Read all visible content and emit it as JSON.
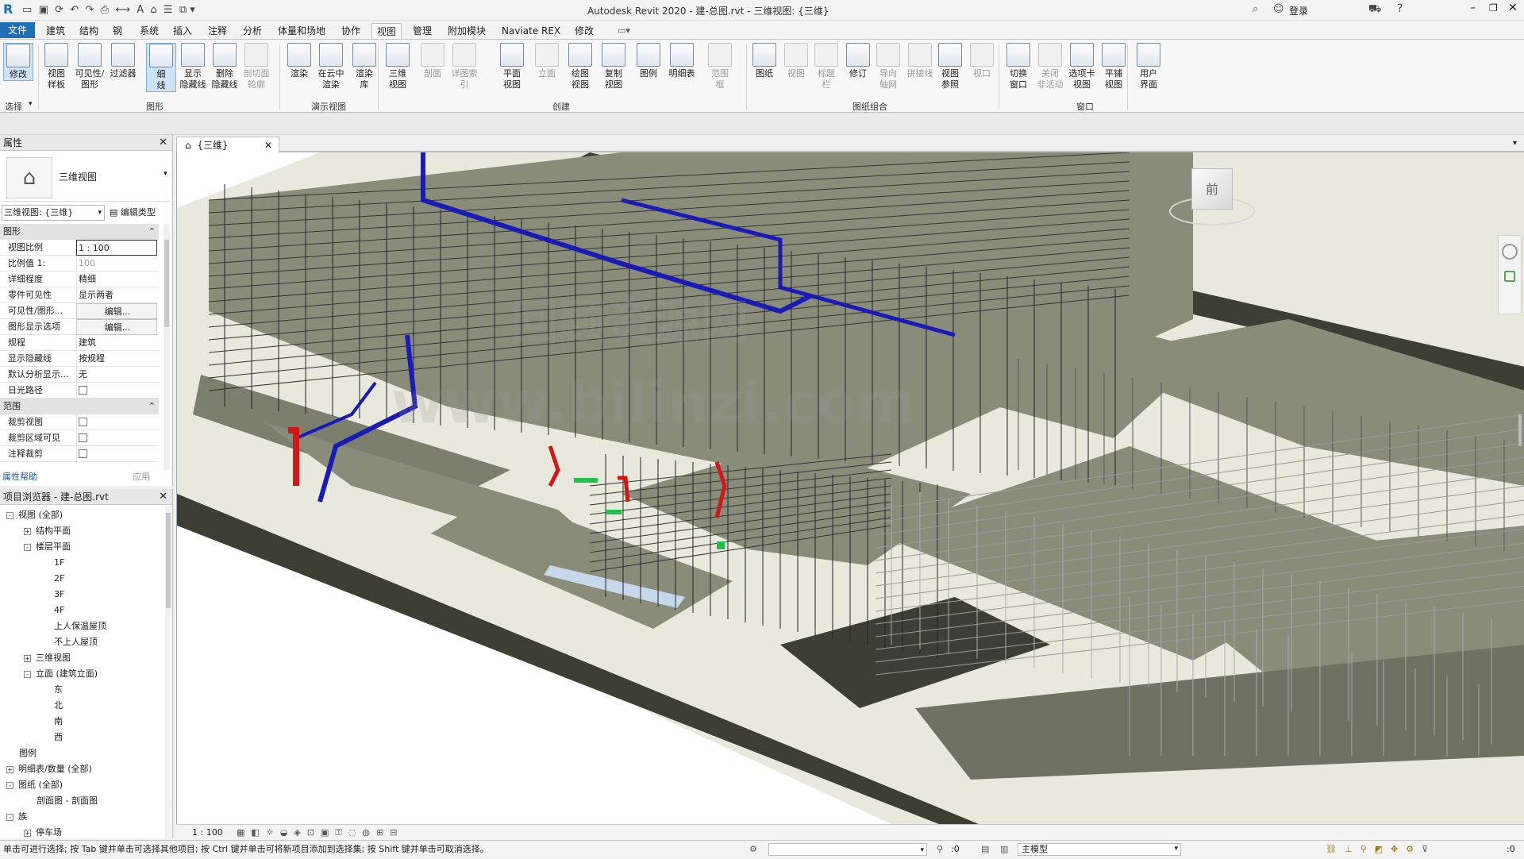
{
  "window": {
    "title": "Autodesk Revit 2020 - 建-总图.rvt - 三维视图: {三维}",
    "login": "登录"
  },
  "tabs": [
    "文件",
    "建筑",
    "结构",
    "钢",
    "系统",
    "插入",
    "注释",
    "分析",
    "体量和场地",
    "协作",
    "视图",
    "管理",
    "附加模块",
    "Naviate REX",
    "修改"
  ],
  "active_tab": "视图",
  "ribbon": {
    "buttons": [
      {
        "label": "修改",
        "sub": "",
        "state": "sel"
      },
      {
        "label": "视图",
        "sub": "样板",
        "state": ""
      },
      {
        "label": "可见性/",
        "sub": "图形",
        "state": ""
      },
      {
        "label": "过滤器",
        "sub": "",
        "state": ""
      },
      {
        "label": "细",
        "sub": "线",
        "state": "sel"
      },
      {
        "label": "显示",
        "sub": "隐藏线",
        "state": ""
      },
      {
        "label": "删除",
        "sub": "隐藏线",
        "state": ""
      },
      {
        "label": "剖切面",
        "sub": "轮廓",
        "state": "dis"
      },
      {
        "label": "渲染",
        "sub": "",
        "state": ""
      },
      {
        "label": "在云中",
        "sub": "渲染",
        "state": ""
      },
      {
        "label": "渲染",
        "sub": "库",
        "state": ""
      },
      {
        "label": "三维",
        "sub": "视图",
        "state": ""
      },
      {
        "label": "剖面",
        "sub": "",
        "state": "dis"
      },
      {
        "label": "详图索引",
        "sub": "",
        "state": "dis"
      },
      {
        "label": "平面",
        "sub": "视图",
        "state": ""
      },
      {
        "label": "立面",
        "sub": "",
        "state": "dis"
      },
      {
        "label": "绘图",
        "sub": "视图",
        "state": ""
      },
      {
        "label": "复制",
        "sub": "视图",
        "state": ""
      },
      {
        "label": "图例",
        "sub": "",
        "state": ""
      },
      {
        "label": "明细表",
        "sub": "",
        "state": ""
      },
      {
        "label": "范围",
        "sub": "框",
        "state": "dis"
      },
      {
        "label": "图纸",
        "sub": "",
        "state": ""
      },
      {
        "label": "视图",
        "sub": "",
        "state": "dis"
      },
      {
        "label": "标题",
        "sub": "栏",
        "state": "dis"
      },
      {
        "label": "修订",
        "sub": "",
        "state": ""
      },
      {
        "label": "导向",
        "sub": "轴网",
        "state": "dis"
      },
      {
        "label": "拼接线",
        "sub": "",
        "state": "dis"
      },
      {
        "label": "视图",
        "sub": "参照",
        "state": ""
      },
      {
        "label": "视口",
        "sub": "",
        "state": "dis"
      },
      {
        "label": "切换",
        "sub": "窗口",
        "state": ""
      },
      {
        "label": "关闭",
        "sub": "非活动",
        "state": "dis"
      },
      {
        "label": "选项卡",
        "sub": "视图",
        "state": ""
      },
      {
        "label": "平铺",
        "sub": "视图",
        "state": ""
      },
      {
        "label": "用户",
        "sub": "界面",
        "state": ""
      }
    ],
    "groups": [
      "选择",
      "图形",
      "演示视图",
      "创建",
      "图纸组合",
      "窗口"
    ]
  },
  "properties": {
    "title": "属性",
    "type_name": "三维视图",
    "selector": "三维视图: {三维}",
    "edit_type": "编辑类型",
    "section_graphics": "图形",
    "section_extents": "范围",
    "rows": [
      {
        "k": "视图比例",
        "v": "1 : 100",
        "kind": "input"
      },
      {
        "k": "比例值 1:",
        "v": "100",
        "kind": "gray"
      },
      {
        "k": "详细程度",
        "v": "精细",
        "kind": "text"
      },
      {
        "k": "零件可见性",
        "v": "显示两者",
        "kind": "text"
      },
      {
        "k": "可见性/图形...",
        "v": "编辑...",
        "kind": "button"
      },
      {
        "k": "图形显示选项",
        "v": "编辑...",
        "kind": "button"
      },
      {
        "k": "规程",
        "v": "建筑",
        "kind": "text"
      },
      {
        "k": "显示隐藏线",
        "v": "按规程",
        "kind": "text"
      },
      {
        "k": "默认分析显示...",
        "v": "无",
        "kind": "text"
      },
      {
        "k": "日光路径",
        "v": "",
        "kind": "check"
      }
    ],
    "rows2": [
      {
        "k": "裁剪视图",
        "v": "",
        "kind": "check"
      },
      {
        "k": "裁剪区域可见",
        "v": "",
        "kind": "check"
      },
      {
        "k": "注释裁剪",
        "v": "",
        "kind": "check"
      }
    ],
    "help": "属性帮助",
    "apply": "应用"
  },
  "browser": {
    "title": "项目浏览器 - 建-总图.rvt",
    "nodes": [
      {
        "t": "视图 (全部)",
        "lvl": 0,
        "box": "-"
      },
      {
        "t": "结构平面",
        "lvl": 1,
        "box": "+"
      },
      {
        "t": "楼层平面",
        "lvl": 1,
        "box": "-"
      },
      {
        "t": "1F",
        "lvl": 2,
        "box": ""
      },
      {
        "t": "2F",
        "lvl": 2,
        "box": ""
      },
      {
        "t": "3F",
        "lvl": 2,
        "box": ""
      },
      {
        "t": "4F",
        "lvl": 2,
        "box": ""
      },
      {
        "t": "上人保温屋顶",
        "lvl": 2,
        "box": ""
      },
      {
        "t": "不上人屋顶",
        "lvl": 2,
        "box": ""
      },
      {
        "t": "三维视图",
        "lvl": 1,
        "box": "+"
      },
      {
        "t": "立面 (建筑立面)",
        "lvl": 1,
        "box": "-"
      },
      {
        "t": "东",
        "lvl": 2,
        "box": ""
      },
      {
        "t": "北",
        "lvl": 2,
        "box": ""
      },
      {
        "t": "南",
        "lvl": 2,
        "box": ""
      },
      {
        "t": "西",
        "lvl": 2,
        "box": ""
      },
      {
        "t": "图例",
        "lvl": 0,
        "box": ""
      },
      {
        "t": "明细表/数量 (全部)",
        "lvl": 0,
        "box": "+"
      },
      {
        "t": "图纸 (全部)",
        "lvl": 0,
        "box": "-"
      },
      {
        "t": "剖面图 - 剖面图",
        "lvl": 1,
        "box": ""
      },
      {
        "t": "族",
        "lvl": 0,
        "box": "-"
      },
      {
        "t": "停车场",
        "lvl": 1,
        "box": "+"
      }
    ]
  },
  "view": {
    "tab_label": "{三维}",
    "scale": "1 : 100",
    "viewcube_label": "前"
  },
  "status": {
    "hint": "单击可进行选择; 按 Tab 键并单击可选择其他项目; 按 Ctrl 键并单击可将新项目添加到选择集; 按 Shift 键并单击可取消选择。",
    "model": "主模型",
    "count": ":0",
    "filter_count": ":0"
  },
  "colors": {
    "accent": "#1e6fb8",
    "floor": "#e9e8dc",
    "slab": "#8a8c7a",
    "pipe_blue": "#1a1ab4",
    "pipe_red": "#d01818"
  }
}
